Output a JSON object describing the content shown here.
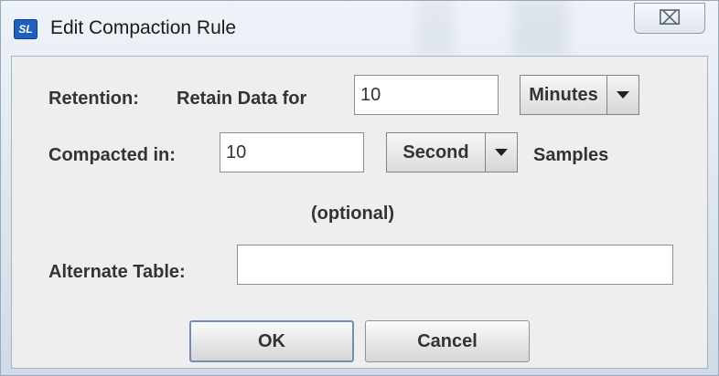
{
  "window": {
    "title": "Edit Compaction Rule",
    "app_icon_text": "SL",
    "close_glyph": "⌧"
  },
  "retention": {
    "section_label": "Retention:",
    "retain_label": "Retain Data for",
    "value": "10",
    "unit_selected": "Minutes"
  },
  "compaction": {
    "label": "Compacted in:",
    "value": "10",
    "unit_selected": "Second",
    "suffix": "Samples"
  },
  "optional_note": "(optional)",
  "alternate_table": {
    "label": "Alternate Table:",
    "value": ""
  },
  "buttons": {
    "ok": "OK",
    "cancel": "Cancel"
  }
}
